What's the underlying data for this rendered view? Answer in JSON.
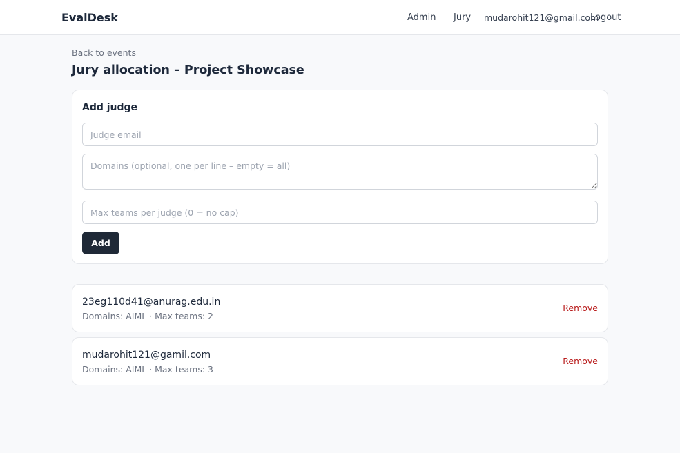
{
  "header": {
    "brand": "EvalDesk",
    "nav": {
      "admin": "Admin",
      "jury": "Jury",
      "user_email": "mudarohit121@gmail.com",
      "logout": "Logout"
    }
  },
  "page": {
    "back_link": "Back to events",
    "title": "Jury allocation – Project Showcase"
  },
  "add_judge": {
    "title": "Add judge",
    "email_placeholder": "Judge email",
    "email_value": "",
    "domains_placeholder": "Domains (optional, one per line – empty = all)",
    "domains_value": "",
    "max_placeholder": "Max teams per judge (0 = no cap)",
    "max_value": "",
    "add_label": "Add"
  },
  "judges": [
    {
      "email": "23eg110d41@anurag.edu.in",
      "meta": "Domains: AIML · Max teams: 2",
      "remove_label": "Remove"
    },
    {
      "email": "mudarohit121@gamil.com",
      "meta": "Domains: AIML · Max teams: 3",
      "remove_label": "Remove"
    }
  ],
  "colors": {
    "background": "#f8f9fb",
    "primary_button": "#1f2937",
    "danger": "#b91c1c",
    "muted_text": "#6b7280"
  }
}
